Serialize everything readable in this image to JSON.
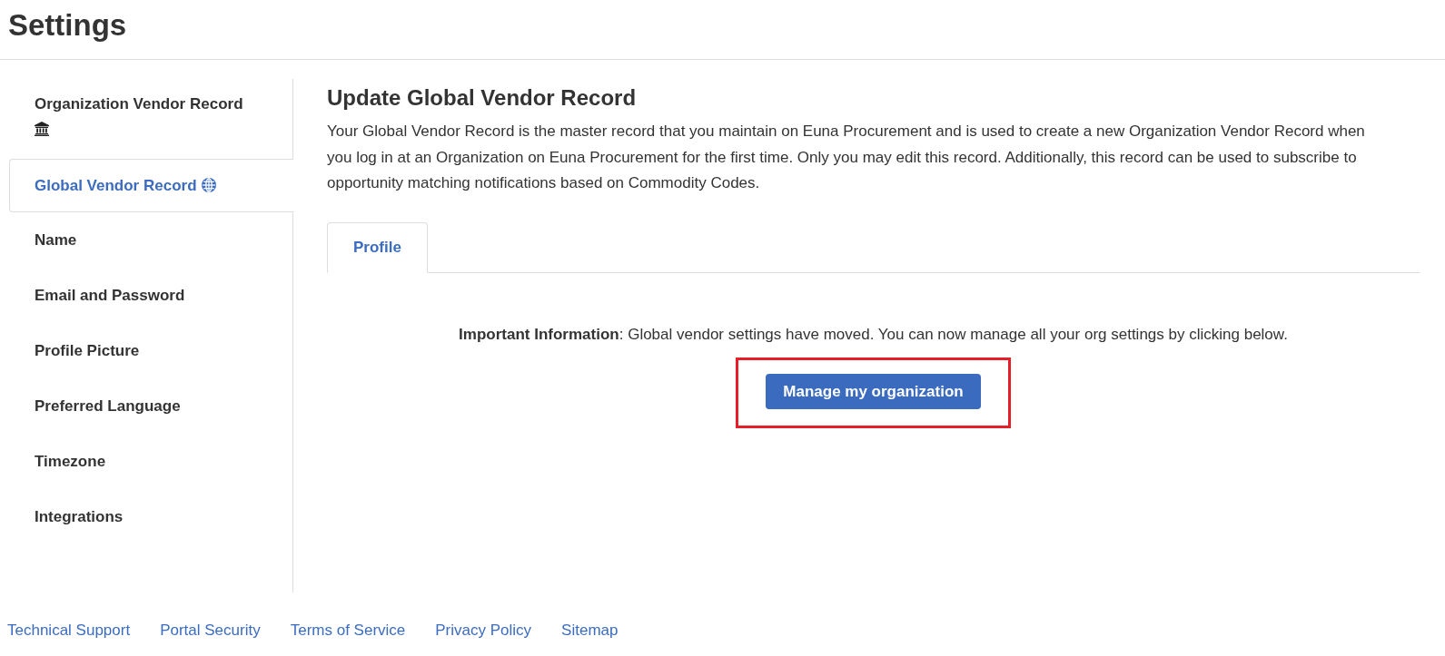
{
  "header": {
    "title": "Settings"
  },
  "sidebar": {
    "items": [
      {
        "label": "Organization Vendor Record",
        "kind": "organization",
        "selected": false
      },
      {
        "label": "Global Vendor Record",
        "kind": "global",
        "selected": true
      },
      {
        "label": "Name",
        "kind": "plain",
        "selected": false
      },
      {
        "label": "Email and Password",
        "kind": "plain",
        "selected": false
      },
      {
        "label": "Profile Picture",
        "kind": "plain",
        "selected": false
      },
      {
        "label": "Preferred Language",
        "kind": "plain",
        "selected": false
      },
      {
        "label": "Timezone",
        "kind": "plain",
        "selected": false
      },
      {
        "label": "Integrations",
        "kind": "plain",
        "selected": false
      }
    ]
  },
  "main": {
    "heading": "Update Global Vendor Record",
    "description": "Your Global Vendor Record is the master record that you maintain on Euna Procurement and is used to create a new Organization Vendor Record when you log in at an Organization on Euna Procurement for the first time. Only you may edit this record. Additionally, this record can be used to subscribe to opportunity matching notifications based on Commodity Codes.",
    "tabs": [
      {
        "label": "Profile",
        "selected": true
      }
    ],
    "notice": "**Important Information**: Global vendor settings have moved. You can now manage all your org settings by clicking below.",
    "action_button": {
      "label": "Manage my organization",
      "highlighted": true
    }
  },
  "footer": {
    "links": [
      "Technical Support",
      "Portal Security",
      "Terms of Service",
      "Privacy Policy",
      "Sitemap"
    ]
  }
}
